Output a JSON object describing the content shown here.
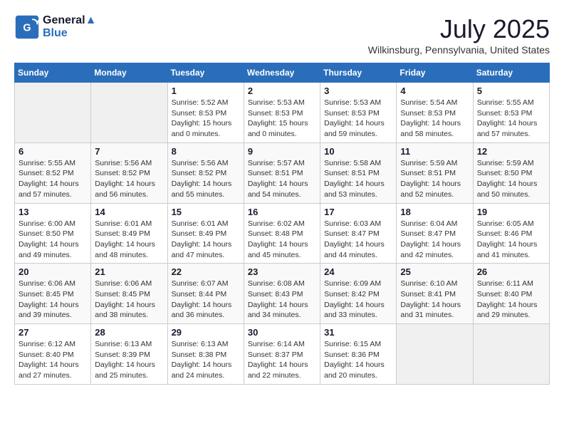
{
  "header": {
    "logo_line1": "General",
    "logo_line2": "Blue",
    "month": "July 2025",
    "location": "Wilkinsburg, Pennsylvania, United States"
  },
  "weekdays": [
    "Sunday",
    "Monday",
    "Tuesday",
    "Wednesday",
    "Thursday",
    "Friday",
    "Saturday"
  ],
  "weeks": [
    [
      {
        "day": "",
        "info": ""
      },
      {
        "day": "",
        "info": ""
      },
      {
        "day": "1",
        "info": "Sunrise: 5:52 AM\nSunset: 8:53 PM\nDaylight: 15 hours\nand 0 minutes."
      },
      {
        "day": "2",
        "info": "Sunrise: 5:53 AM\nSunset: 8:53 PM\nDaylight: 15 hours\nand 0 minutes."
      },
      {
        "day": "3",
        "info": "Sunrise: 5:53 AM\nSunset: 8:53 PM\nDaylight: 14 hours\nand 59 minutes."
      },
      {
        "day": "4",
        "info": "Sunrise: 5:54 AM\nSunset: 8:53 PM\nDaylight: 14 hours\nand 58 minutes."
      },
      {
        "day": "5",
        "info": "Sunrise: 5:55 AM\nSunset: 8:53 PM\nDaylight: 14 hours\nand 57 minutes."
      }
    ],
    [
      {
        "day": "6",
        "info": "Sunrise: 5:55 AM\nSunset: 8:52 PM\nDaylight: 14 hours\nand 57 minutes."
      },
      {
        "day": "7",
        "info": "Sunrise: 5:56 AM\nSunset: 8:52 PM\nDaylight: 14 hours\nand 56 minutes."
      },
      {
        "day": "8",
        "info": "Sunrise: 5:56 AM\nSunset: 8:52 PM\nDaylight: 14 hours\nand 55 minutes."
      },
      {
        "day": "9",
        "info": "Sunrise: 5:57 AM\nSunset: 8:51 PM\nDaylight: 14 hours\nand 54 minutes."
      },
      {
        "day": "10",
        "info": "Sunrise: 5:58 AM\nSunset: 8:51 PM\nDaylight: 14 hours\nand 53 minutes."
      },
      {
        "day": "11",
        "info": "Sunrise: 5:59 AM\nSunset: 8:51 PM\nDaylight: 14 hours\nand 52 minutes."
      },
      {
        "day": "12",
        "info": "Sunrise: 5:59 AM\nSunset: 8:50 PM\nDaylight: 14 hours\nand 50 minutes."
      }
    ],
    [
      {
        "day": "13",
        "info": "Sunrise: 6:00 AM\nSunset: 8:50 PM\nDaylight: 14 hours\nand 49 minutes."
      },
      {
        "day": "14",
        "info": "Sunrise: 6:01 AM\nSunset: 8:49 PM\nDaylight: 14 hours\nand 48 minutes."
      },
      {
        "day": "15",
        "info": "Sunrise: 6:01 AM\nSunset: 8:49 PM\nDaylight: 14 hours\nand 47 minutes."
      },
      {
        "day": "16",
        "info": "Sunrise: 6:02 AM\nSunset: 8:48 PM\nDaylight: 14 hours\nand 45 minutes."
      },
      {
        "day": "17",
        "info": "Sunrise: 6:03 AM\nSunset: 8:47 PM\nDaylight: 14 hours\nand 44 minutes."
      },
      {
        "day": "18",
        "info": "Sunrise: 6:04 AM\nSunset: 8:47 PM\nDaylight: 14 hours\nand 42 minutes."
      },
      {
        "day": "19",
        "info": "Sunrise: 6:05 AM\nSunset: 8:46 PM\nDaylight: 14 hours\nand 41 minutes."
      }
    ],
    [
      {
        "day": "20",
        "info": "Sunrise: 6:06 AM\nSunset: 8:45 PM\nDaylight: 14 hours\nand 39 minutes."
      },
      {
        "day": "21",
        "info": "Sunrise: 6:06 AM\nSunset: 8:45 PM\nDaylight: 14 hours\nand 38 minutes."
      },
      {
        "day": "22",
        "info": "Sunrise: 6:07 AM\nSunset: 8:44 PM\nDaylight: 14 hours\nand 36 minutes."
      },
      {
        "day": "23",
        "info": "Sunrise: 6:08 AM\nSunset: 8:43 PM\nDaylight: 14 hours\nand 34 minutes."
      },
      {
        "day": "24",
        "info": "Sunrise: 6:09 AM\nSunset: 8:42 PM\nDaylight: 14 hours\nand 33 minutes."
      },
      {
        "day": "25",
        "info": "Sunrise: 6:10 AM\nSunset: 8:41 PM\nDaylight: 14 hours\nand 31 minutes."
      },
      {
        "day": "26",
        "info": "Sunrise: 6:11 AM\nSunset: 8:40 PM\nDaylight: 14 hours\nand 29 minutes."
      }
    ],
    [
      {
        "day": "27",
        "info": "Sunrise: 6:12 AM\nSunset: 8:40 PM\nDaylight: 14 hours\nand 27 minutes."
      },
      {
        "day": "28",
        "info": "Sunrise: 6:13 AM\nSunset: 8:39 PM\nDaylight: 14 hours\nand 25 minutes."
      },
      {
        "day": "29",
        "info": "Sunrise: 6:13 AM\nSunset: 8:38 PM\nDaylight: 14 hours\nand 24 minutes."
      },
      {
        "day": "30",
        "info": "Sunrise: 6:14 AM\nSunset: 8:37 PM\nDaylight: 14 hours\nand 22 minutes."
      },
      {
        "day": "31",
        "info": "Sunrise: 6:15 AM\nSunset: 8:36 PM\nDaylight: 14 hours\nand 20 minutes."
      },
      {
        "day": "",
        "info": ""
      },
      {
        "day": "",
        "info": ""
      }
    ]
  ]
}
